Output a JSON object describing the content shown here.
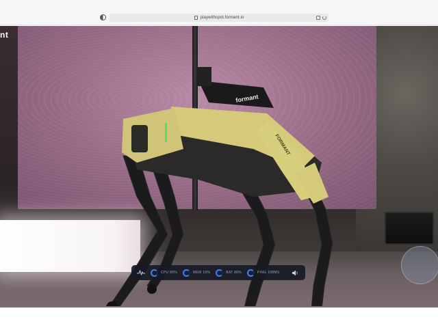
{
  "browser": {
    "url": "playwithspot.formant.io"
  },
  "page": {
    "logo_fragment": "nt",
    "robot_brand_label": "formant",
    "robot_side_label": "FORMANT"
  },
  "status_bar": {
    "items": [
      {
        "label": "CPU 86%",
        "value": 86
      },
      {
        "label": "MEM 19%",
        "value": 19
      },
      {
        "label": "BAT 86%",
        "value": 86
      },
      {
        "label": "PING 108MS",
        "value": 108
      }
    ]
  },
  "icons": {
    "shield": "shield-icon",
    "lock": "lock-icon",
    "reader": "reader-icon",
    "refresh": "refresh-icon",
    "pulse": "pulse-icon",
    "volume": "volume-icon"
  },
  "colors": {
    "gauge_accent": "#3a82f6",
    "status_bg": "#161a24",
    "panel_pink": "#b98aa6",
    "robot_yellow": "#d8cf7e"
  }
}
